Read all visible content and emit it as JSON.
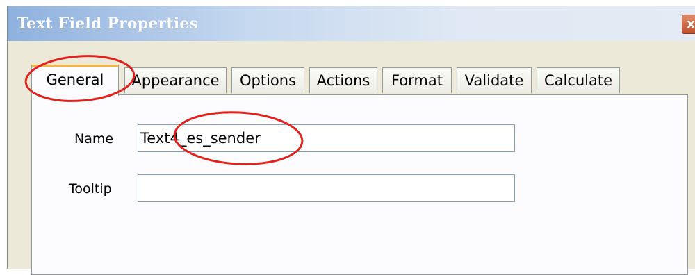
{
  "window": {
    "title": "Text Field Properties",
    "close_label": "x"
  },
  "tabs": [
    {
      "label": "General",
      "active": true
    },
    {
      "label": "Appearance",
      "active": false
    },
    {
      "label": "Options",
      "active": false
    },
    {
      "label": "Actions",
      "active": false
    },
    {
      "label": "Format",
      "active": false
    },
    {
      "label": "Validate",
      "active": false
    },
    {
      "label": "Calculate",
      "active": false
    }
  ],
  "general": {
    "name_label": "Name",
    "name_value": "Text4_es_sender",
    "tooltip_label": "Tooltip",
    "tooltip_value": ""
  },
  "colors": {
    "annotation": "#e3211c",
    "active_tab_accent": "#f2b544",
    "dialog_bg": "#ece9d8"
  }
}
